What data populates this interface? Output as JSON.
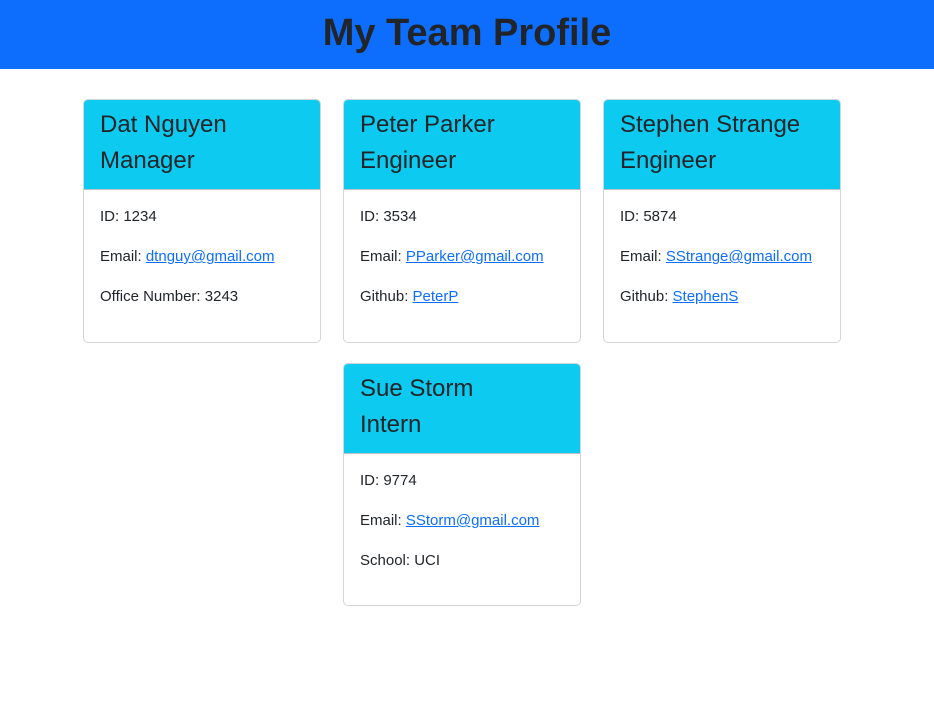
{
  "header": {
    "title": "My Team Profile"
  },
  "cards": [
    {
      "name": "Dat Nguyen",
      "role": "Manager",
      "id_label": "ID: ",
      "id": "1234",
      "email_label": "Email: ",
      "email": "dtnguy@gmail.com",
      "extra_label": "Office Number: ",
      "extra": "3243"
    },
    {
      "name": "Peter Parker",
      "role": "Engineer",
      "id_label": "ID: ",
      "id": "3534",
      "email_label": "Email: ",
      "email": "PParker@gmail.com",
      "extra_label": "Github: ",
      "extra": "PeterP"
    },
    {
      "name": "Stephen Strange",
      "role": "Engineer",
      "id_label": "ID: ",
      "id": "5874",
      "email_label": "Email: ",
      "email": "SStrange@gmail.com",
      "extra_label": "Github: ",
      "extra": "StephenS"
    },
    {
      "name": "Sue Storm",
      "role": "Intern",
      "id_label": "ID: ",
      "id": "9774",
      "email_label": "Email: ",
      "email": "SStorm@gmail.com",
      "extra_label": "School: ",
      "extra": "UCI"
    }
  ],
  "colors": {
    "header_bg": "#0d6efd",
    "card_header_bg": "#0dcaf0",
    "link": "#0d6efd"
  }
}
